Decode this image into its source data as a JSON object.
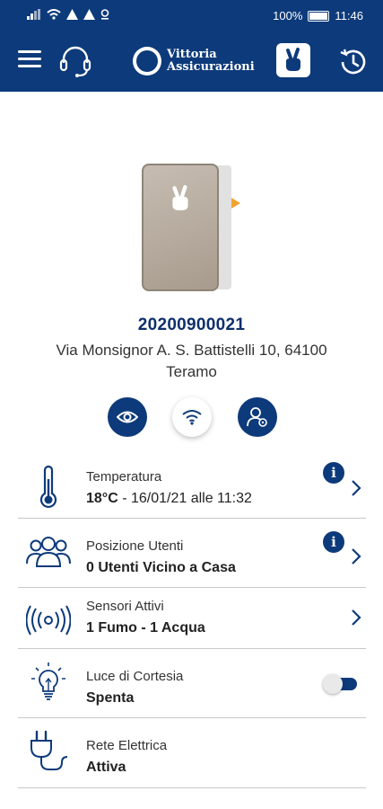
{
  "status_bar": {
    "battery_pct": "100%",
    "time": "11:46"
  },
  "header": {
    "logo_line1": "Vittoria",
    "logo_line2": "Assicurazioni"
  },
  "device": {
    "id": "20200900021",
    "address": "Via Monsignor A. S. Battistelli 10, 64100 Teramo"
  },
  "actions": [
    {
      "icon": "eye-icon"
    },
    {
      "icon": "wifi-icon"
    },
    {
      "icon": "user-settings-icon"
    }
  ],
  "rows": {
    "temperature": {
      "title": "Temperatura",
      "value_bold": "18°C",
      "value_rest": " - 16/01/21 alle 11:32",
      "icon": "thermometer-icon"
    },
    "users": {
      "title": "Posizione Utenti",
      "value": "0 Utenti Vicino a Casa",
      "icon": "users-icon"
    },
    "sensors": {
      "title": "Sensori Attivi",
      "value": "1 Fumo - 1 Acqua",
      "icon": "sensor-signal-icon"
    },
    "courtesy_light": {
      "title": "Luce di Cortesia",
      "value": "Spenta",
      "icon": "lightbulb-icon",
      "toggle_on": false
    },
    "power": {
      "title": "Rete Elettrica",
      "value": "Attiva",
      "icon": "power-plug-icon"
    }
  },
  "colors": {
    "primary": "#0d3a7a",
    "device_body": "#b4a99c",
    "led": "#f3a230"
  }
}
